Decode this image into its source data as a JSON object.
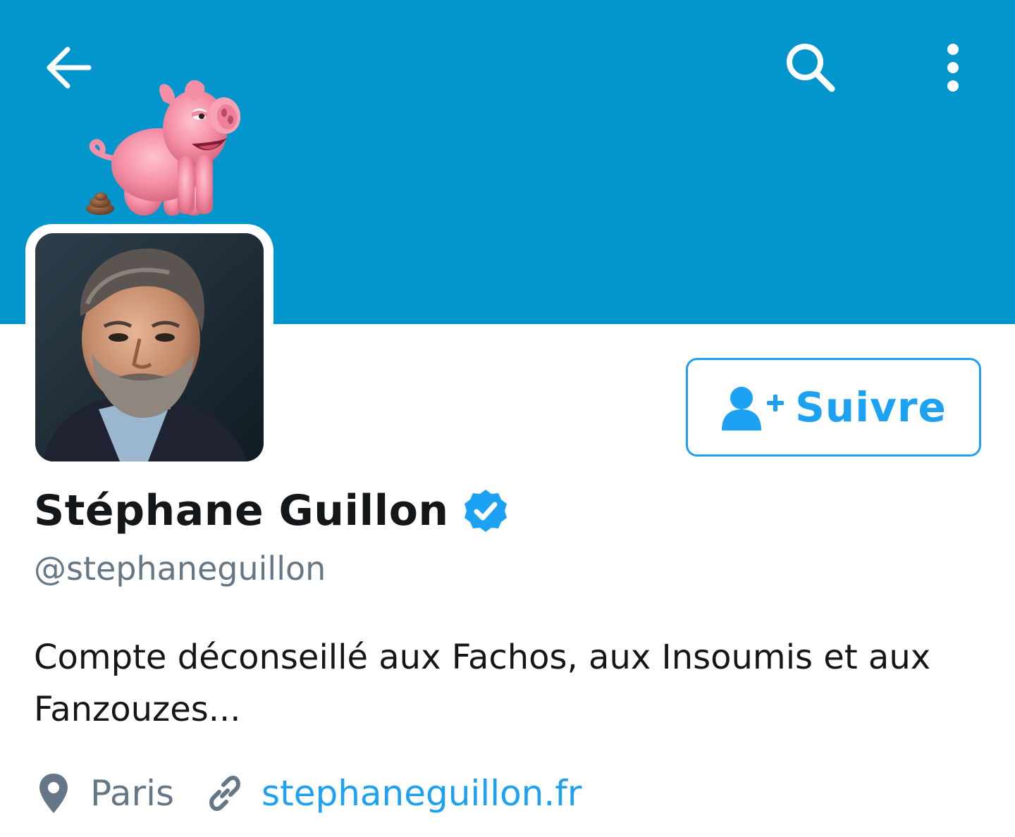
{
  "header": {
    "back_icon": "back-arrow-icon",
    "search_icon": "search-icon",
    "more_icon": "more-vertical-icon",
    "banner_color": "#0296cc"
  },
  "profile": {
    "name": "Stéphane Guillon",
    "verified": true,
    "handle": "@stephaneguillon",
    "bio": "Compte déconseillé aux Fachos, aux Insoumis et aux Fanzouzes...",
    "location": "Paris",
    "website": "stephaneguillon.fr"
  },
  "follow_button": {
    "label": "Suivre",
    "icon": "add-user-icon",
    "accent_color": "#1da1f2"
  }
}
